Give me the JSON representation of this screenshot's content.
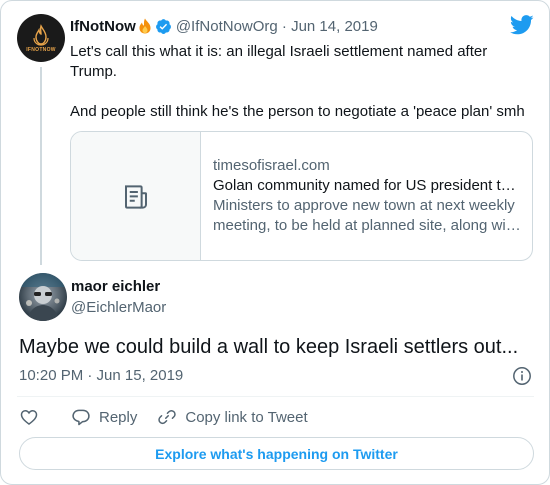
{
  "quoted_tweet": {
    "avatar_label": "IFNOTNOW",
    "name": "IfNotNow",
    "handle_date": "@IfNotNowOrg · Jun 14, 2019",
    "text_lines": [
      "Let's call this what it is: an illegal Israeli settlement named after Trump.",
      "And people still think he's the person to negotiate a 'peace plan' smh"
    ],
    "link_card": {
      "domain": "timesofisrael.com",
      "title": "Golan community named for US president to be dedicated at ceremony",
      "description": "Ministers to approve new town at next weekly meeting, to be held at planned site, along with Netanyahu and US ambassador"
    }
  },
  "main_tweet": {
    "name": "maor eichler",
    "handle": "@EichlerMaor",
    "text": "Maybe we could build a wall to keep Israeli settlers out...",
    "timestamp": "10:20 PM · Jun 15, 2019"
  },
  "actions": {
    "reply_label": "Reply",
    "copy_link_label": "Copy link to Tweet"
  },
  "explore_label": "Explore what's happening on Twitter",
  "colors": {
    "accent": "#1d9bf0",
    "secondary_text": "#536471",
    "border": "#cfd9de"
  }
}
